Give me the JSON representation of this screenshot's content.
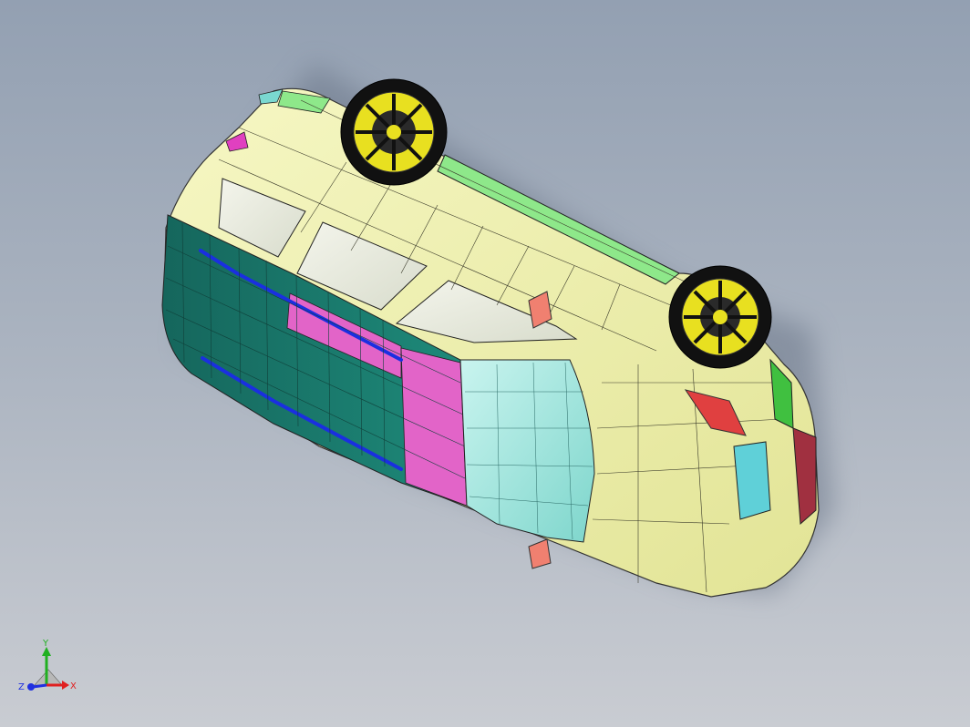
{
  "viewport": {
    "background_top": "#93a0b2",
    "background_bottom": "#c9ccd2"
  },
  "model": {
    "body_color": "#eef0a8",
    "side_panel_color": "#1a7a6c",
    "door_accent_color": "#e264c8",
    "windshield_color": "#9fe3dc",
    "roof_rail_color": "#8ee88a",
    "wheel_color": "#111111",
    "rim_color": "#e8e020",
    "trim_color": "#1a2fe0",
    "mirror_color": "#f08070",
    "headlight_color": "#e04040"
  },
  "triad": {
    "x_label": "X",
    "y_label": "Y",
    "z_label": "Z",
    "x_color": "#e02020",
    "y_color": "#20b020",
    "z_color": "#2030e0"
  }
}
